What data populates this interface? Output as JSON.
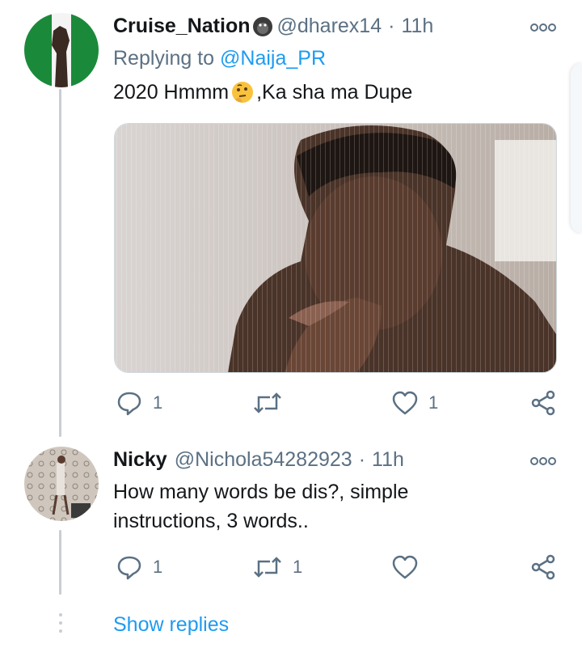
{
  "tweets": [
    {
      "display_name": "Cruise_Nation",
      "name_emoji": "gorilla-emoji",
      "handle": "@dharex14",
      "separator": "·",
      "time": "11h",
      "replying_prefix": "Replying to",
      "replying_to": "@Naija_PR",
      "text_before": "2020 Hmmm",
      "text_emoji": "thinking-face-emoji",
      "text_after": ",Ka sha ma Dupe",
      "has_media": true,
      "actions": {
        "reply_count": "1",
        "retweet_count": "",
        "like_count": "1"
      }
    },
    {
      "display_name": "Nicky",
      "handle": "@Nichola54282923",
      "separator": "·",
      "time": "11h",
      "text_line1": "How many words be dis?, simple",
      "text_line2": "instructions, 3 words..",
      "actions": {
        "reply_count": "1",
        "retweet_count": "1",
        "like_count": ""
      }
    }
  ],
  "show_replies_label": "Show replies",
  "icons": [
    "more-icon",
    "reply-icon",
    "retweet-icon",
    "like-icon",
    "share-icon"
  ],
  "colors": {
    "link": "#1d9bf0",
    "secondary": "#5b7083",
    "thread_line": "#c8ced3"
  }
}
